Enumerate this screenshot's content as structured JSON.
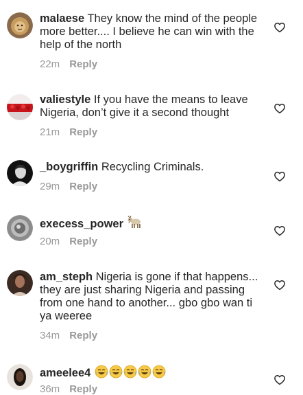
{
  "comments": [
    {
      "username": "malaese",
      "text": "They know the mind of the people more better.... I believe he can win with the help of the north",
      "time": "22m",
      "reply": "Reply",
      "avatar_icon": "lion-avatar"
    },
    {
      "username": "valiestyle",
      "text": "If you have the means to leave Nigeria, don’t give it a second thought",
      "time": "21m",
      "reply": "Reply",
      "avatar_icon": "red-items-avatar"
    },
    {
      "username": "_boygriffin",
      "text": "Recycling Criminals.",
      "time": "29m",
      "reply": "Reply",
      "avatar_icon": "bw-portrait-avatar"
    },
    {
      "username": "execess_power",
      "text": "",
      "emoji": "goat",
      "time": "20m",
      "reply": "Reply",
      "avatar_icon": "round-object-avatar"
    },
    {
      "username": "am_steph",
      "text": "Nigeria is gone if that happens... they are just sharing Nigeria and passing from one hand to another... gbo gbo wan ti ya weeree",
      "time": "34m",
      "reply": "Reply",
      "avatar_icon": "woman-portrait-avatar"
    },
    {
      "username": "ameelee4",
      "text": "",
      "emoji": "tears-of-joy x5",
      "time": "36m",
      "reply": "Reply",
      "avatar_icon": "dark-portrait-avatar"
    }
  ],
  "colors": {
    "text": "#262626",
    "meta": "#999999",
    "background": "#ffffff"
  },
  "icons": {
    "like": "heart-outline-icon",
    "laugh": "face-with-tears-of-joy-icon",
    "goat": "goat-icon"
  }
}
